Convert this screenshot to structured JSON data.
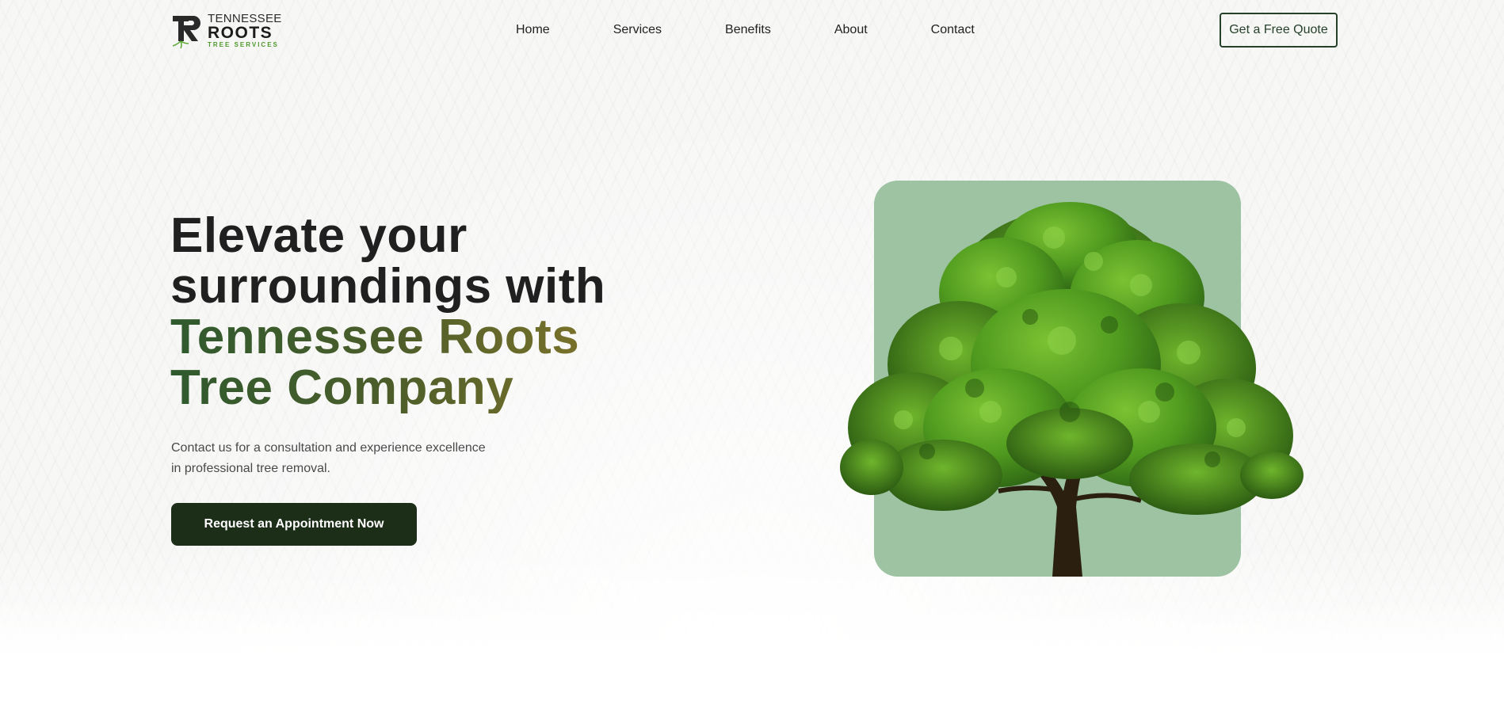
{
  "logo": {
    "line1": "TENNESSEE",
    "line2": "ROOTS",
    "line3": "TREE SERVICES",
    "icon": "tr-monogram-logo"
  },
  "nav": {
    "items": [
      {
        "label": "Home"
      },
      {
        "label": "Services"
      },
      {
        "label": "Benefits"
      },
      {
        "label": "About"
      },
      {
        "label": "Contact"
      }
    ],
    "cta_label": "Get a Free Quote"
  },
  "hero": {
    "title_line1": "Elevate your",
    "title_line2": "surroundings with",
    "title_accent_line1": "Tennessee Roots",
    "title_accent_line2": "Tree Company",
    "subtitle_line1": "Contact us for a consultation and experience excellence",
    "subtitle_line2": "in professional tree removal.",
    "cta_label": "Request an Appointment Now",
    "image": "tree-illustration"
  },
  "colors": {
    "brand_dark_green": "#1c2e18",
    "accent_green": "#2f5a2e",
    "accent_gold": "#8b7a2a",
    "card_green": "#9dc3a3",
    "logo_green": "#4f9a2c"
  }
}
